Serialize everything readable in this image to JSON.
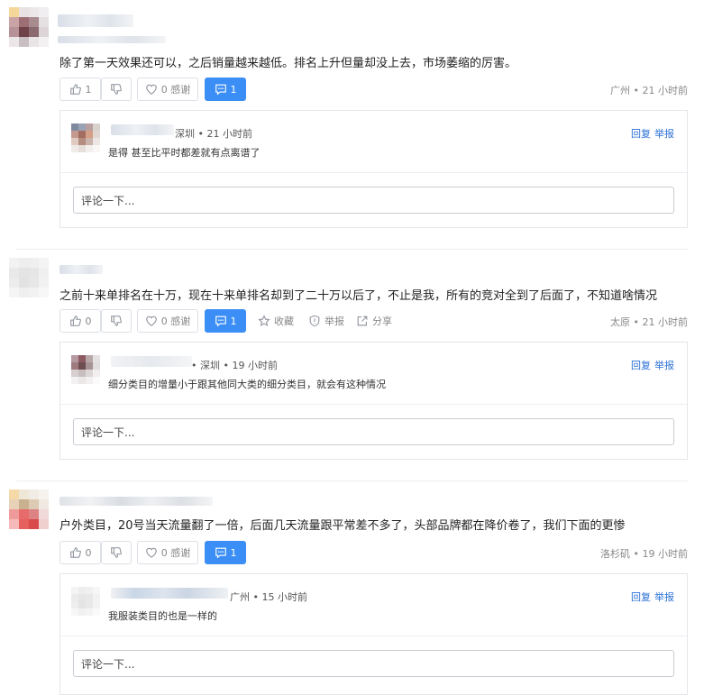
{
  "comments": [
    {
      "text": "除了第一天效果还可以，之后销量越来越低。排名上升但量却没上去，市场萎缩的厉害。",
      "likes": "1",
      "thanks": "0 感谢",
      "replies": "1",
      "meta": "广州 • 21 小时前",
      "show_extra_actions": false,
      "reply": {
        "meta": "深圳 • 21 小时前",
        "text": "是得 甚至比平时都差就有点离谱了"
      },
      "input_placeholder": "评论一下..."
    },
    {
      "text": "之前十来单排名在十万，现在十来单排名却到了二十万以后了，不止是我，所有的竞对全到了后面了，不知道啥情况",
      "likes": "0",
      "thanks": "0 感谢",
      "replies": "1",
      "meta": "太原 • 21 小时前",
      "show_extra_actions": true,
      "reply": {
        "meta": "• 深圳 • 19 小时前",
        "text": "细分类目的增量小于跟其他同大类的细分类目，就会有这种情况"
      },
      "input_placeholder": "评论一下..."
    },
    {
      "text": "户外类目，20号当天流量翻了一倍，后面几天流量跟平常差不多了，头部品牌都在降价卷了，我们下面的更惨",
      "likes": "0",
      "thanks": "0 感谢",
      "replies": "1",
      "meta": "洛杉矶 • 19 小时前",
      "show_extra_actions": false,
      "reply": {
        "meta": "广州 • 15 小时前",
        "text": "我服装类目的也是一样的"
      },
      "input_placeholder": "评论一下..."
    }
  ],
  "actions": {
    "collect": "收藏",
    "report": "举报",
    "share": "分享"
  },
  "reply_links": {
    "reply": "回复",
    "report": "举报"
  },
  "colors": {
    "accent": "#3b8ef5",
    "link": "#2a6fd6",
    "muted": "#888888"
  },
  "icons": [
    "thumb-up-icon",
    "thumb-down-icon",
    "heart-icon",
    "comment-icon",
    "star-icon",
    "shield-icon",
    "share-icon"
  ]
}
